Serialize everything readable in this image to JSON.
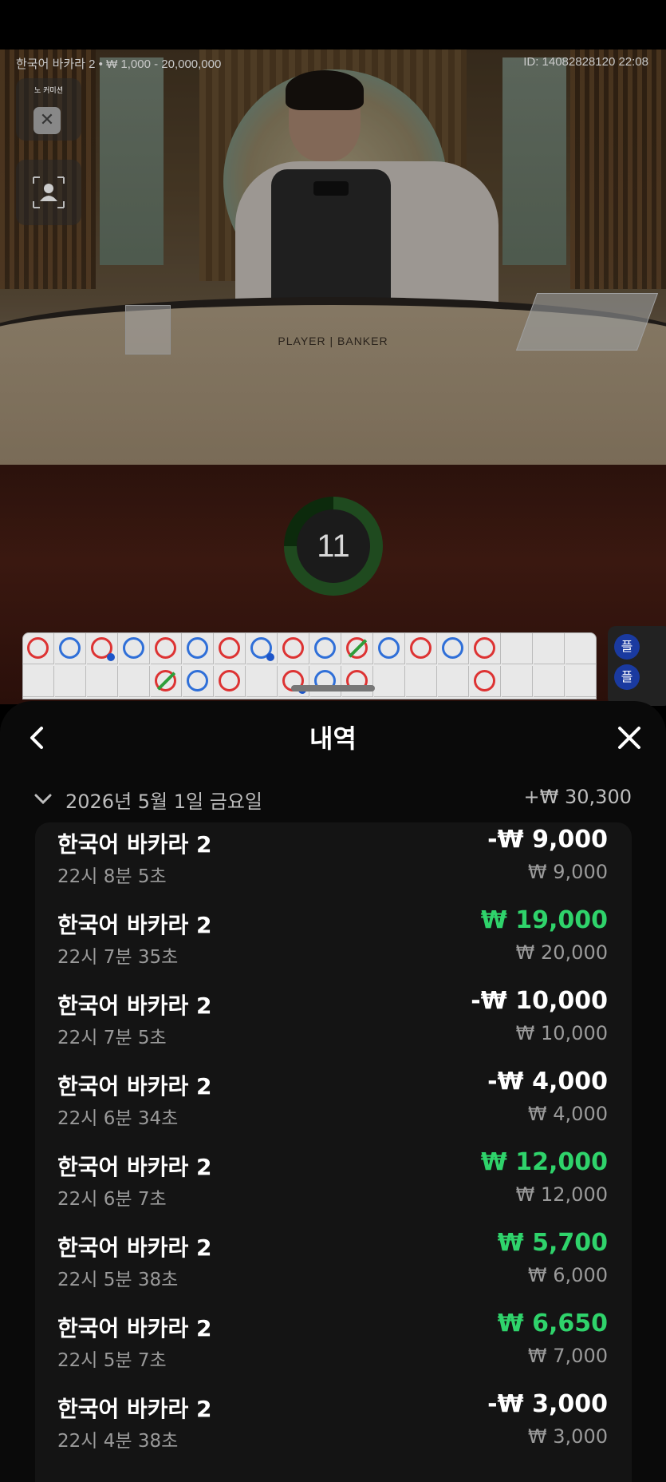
{
  "stream": {
    "table_info": "한국어 바카라 2 • ₩ 1,000 - 20,000,000",
    "round_id": "ID: 14082828120 22:08",
    "no_commission_label": "노 커미션",
    "table_text": "PLAYER | BANKER",
    "countdown": "11"
  },
  "road": {
    "row1": [
      "r",
      "b",
      "r",
      "b",
      "r",
      "b",
      "r",
      "b",
      "r",
      "b",
      "r",
      "b",
      "r",
      "b",
      "r"
    ],
    "row2": [
      "",
      "",
      "",
      "",
      "r",
      "b",
      "r",
      "",
      "r",
      "b",
      "r",
      "",
      "",
      "",
      "r"
    ],
    "side_chip": "플"
  },
  "history": {
    "title": "내역",
    "date": "2026년 5월 1일 금요일",
    "date_total": "+₩ 30,300",
    "entries": [
      {
        "name": "한국어 바카라 2",
        "time": "22시 8분 5초",
        "result": "-₩ 9,000",
        "bet": "₩ 9,000"
      },
      {
        "name": "한국어 바카라 2",
        "time": "22시 7분 35초",
        "result": "₩ 19,000",
        "bet": "₩ 20,000"
      },
      {
        "name": "한국어 바카라 2",
        "time": "22시 7분 5초",
        "result": "-₩ 10,000",
        "bet": "₩ 10,000"
      },
      {
        "name": "한국어 바카라 2",
        "time": "22시 6분 34초",
        "result": "-₩ 4,000",
        "bet": "₩ 4,000"
      },
      {
        "name": "한국어 바카라 2",
        "time": "22시 6분 7초",
        "result": "₩ 12,000",
        "bet": "₩ 12,000"
      },
      {
        "name": "한국어 바카라 2",
        "time": "22시 5분 38초",
        "result": "₩ 5,700",
        "bet": "₩ 6,000"
      },
      {
        "name": "한국어 바카라 2",
        "time": "22시 5분 7초",
        "result": "₩ 6,650",
        "bet": "₩ 7,000"
      },
      {
        "name": "한국어 바카라 2",
        "time": "22시 4분 38초",
        "result": "-₩ 3,000",
        "bet": "₩ 3,000"
      }
    ]
  },
  "colors": {
    "win": "#2fd36b",
    "loss": "#ffffff",
    "banker": "#d33333",
    "player": "#2f6fd8",
    "tie": "#2e9e3a"
  }
}
